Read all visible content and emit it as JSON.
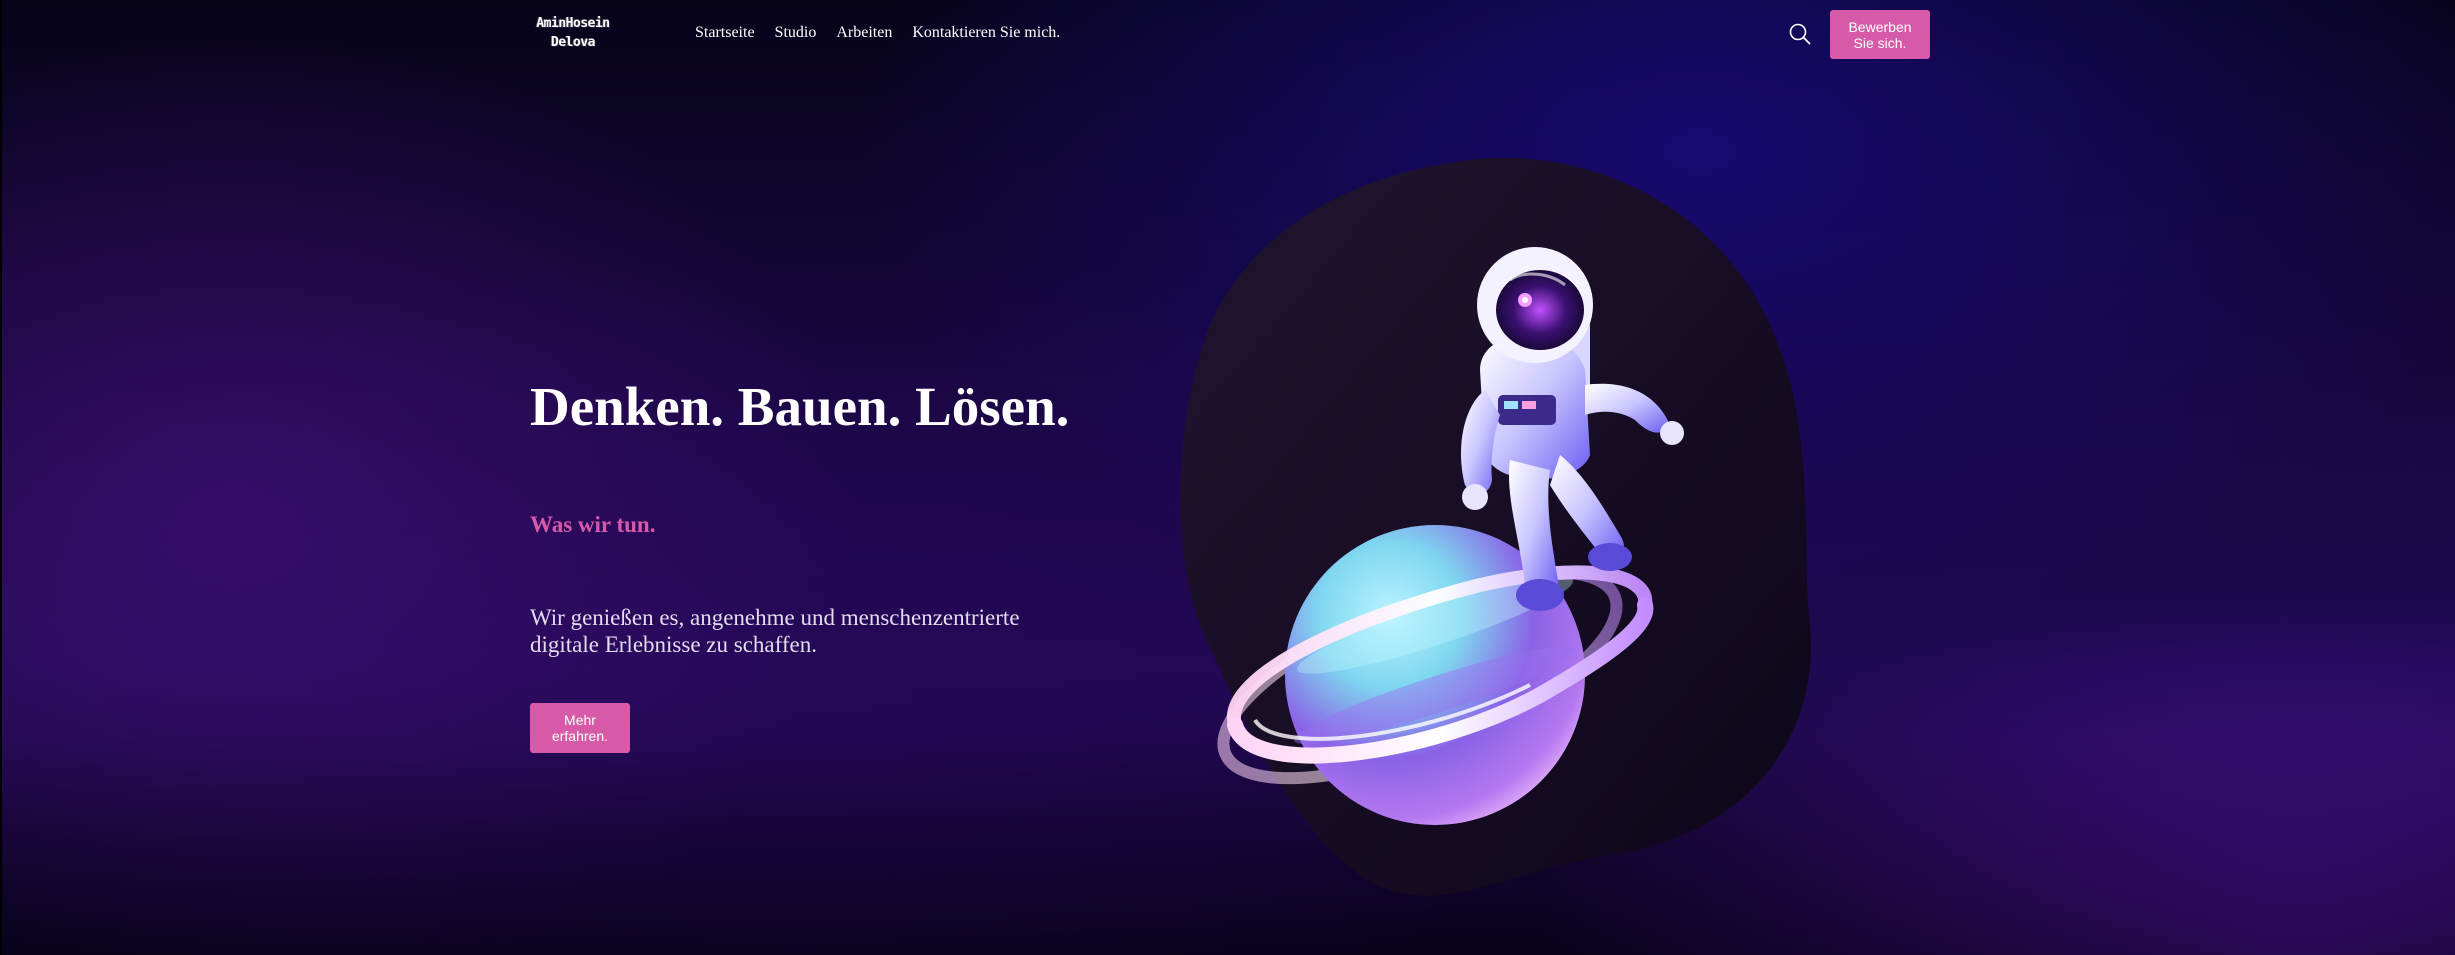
{
  "header": {
    "logo_line1": "AminHosein",
    "logo_line2": "Delova",
    "nav": [
      {
        "label": "Startseite"
      },
      {
        "label": "Studio"
      },
      {
        "label": "Arbeiten"
      },
      {
        "label": "Kontaktieren Sie mich."
      }
    ],
    "search_icon": "search-icon",
    "apply_label": "Bewerben Sie sich."
  },
  "hero": {
    "title": "Denken. Bauen. Lösen.",
    "subtitle": "Was wir tun.",
    "description": "Wir genießen es, angenehme und menschenzentrierte digitale Erlebnisse zu schaffen.",
    "cta_label": "Mehr erfahren."
  },
  "illustration": {
    "subject": "astronaut-on-planet-illustration"
  },
  "colors": {
    "accent": "#d65aa8",
    "background_dark": "#0b0420",
    "background_purple": "#1e0a52",
    "blob": "#1c1028"
  }
}
